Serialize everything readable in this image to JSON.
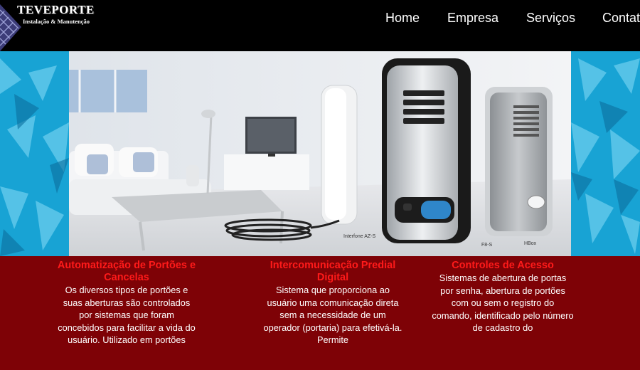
{
  "header": {
    "brand_title": "TEVEPORTE",
    "brand_subtitle": "Instalação & Manutenção",
    "logo_icon": "diamond-grid-logo"
  },
  "nav": {
    "items": [
      {
        "label": "Home"
      },
      {
        "label": "Empresa"
      },
      {
        "label": "Serviços"
      },
      {
        "label": "Contat"
      }
    ]
  },
  "banner": {
    "product_labels": [
      "Interfone AZ-S",
      "F8-S",
      "HBox"
    ],
    "accent_color": "#1aa0d0"
  },
  "services": [
    {
      "title": "Automatização de Portões e Cancelas",
      "body": "Os diversos tipos de portões e suas aberturas são controlados por sistemas que foram concebidos para facilitar a vida do usuário. Utilizado em portões"
    },
    {
      "title": "Intercomunicação Predial Digital",
      "body": "Sistema que proporciona ao usuário uma comunicação direta sem a necessidade de um operador (portaria) para efetivá-la. Permite"
    },
    {
      "title": "Controles de Acesso",
      "body": "Sistemas de abertura de portas por senha, abertura de portões com ou sem o registro do comando, identificado pelo número de cadastro do"
    }
  ],
  "colors": {
    "header_bg": "#000000",
    "services_bg": "#7e0206",
    "service_title": "#ff1a1a"
  }
}
